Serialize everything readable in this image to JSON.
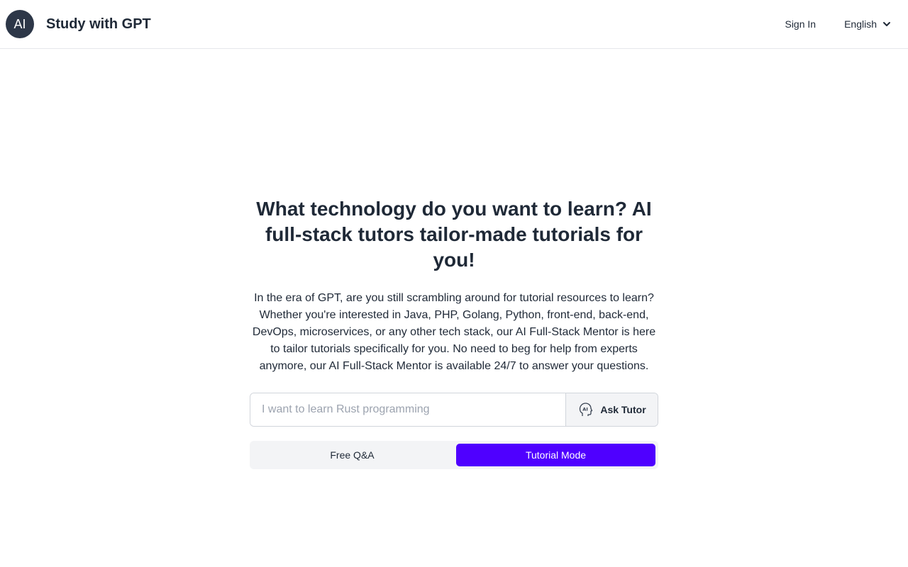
{
  "header": {
    "logo_text": "AI",
    "title": "Study with GPT",
    "sign_in": "Sign In",
    "language": "English",
    "language_icon": "chevron-down-icon"
  },
  "hero": {
    "heading": "What technology do you want to learn? AI full-stack tutors tailor-made tutorials for you!",
    "description": "In the era of GPT, are you still scrambling around for tutorial resources to learn? Whether you're interested in Java, PHP, Golang, Python, front-end, back-end, DevOps, microservices, or any other tech stack, our AI Full-Stack Mentor is here to tailor tutorials specifically for you. No need to beg for help from experts anymore, our AI Full-Stack Mentor is available 24/7 to answer your questions."
  },
  "ask": {
    "value": "",
    "placeholder": "I want to learn Rust programming",
    "button_label": "Ask Tutor",
    "button_icon": "ai-head-icon"
  },
  "modes": {
    "options": [
      "Free Q&A",
      "Tutorial Mode"
    ],
    "selected": "Tutorial Mode"
  },
  "colors": {
    "accent": "#4f00ff",
    "logo_bg": "#2d3748"
  }
}
